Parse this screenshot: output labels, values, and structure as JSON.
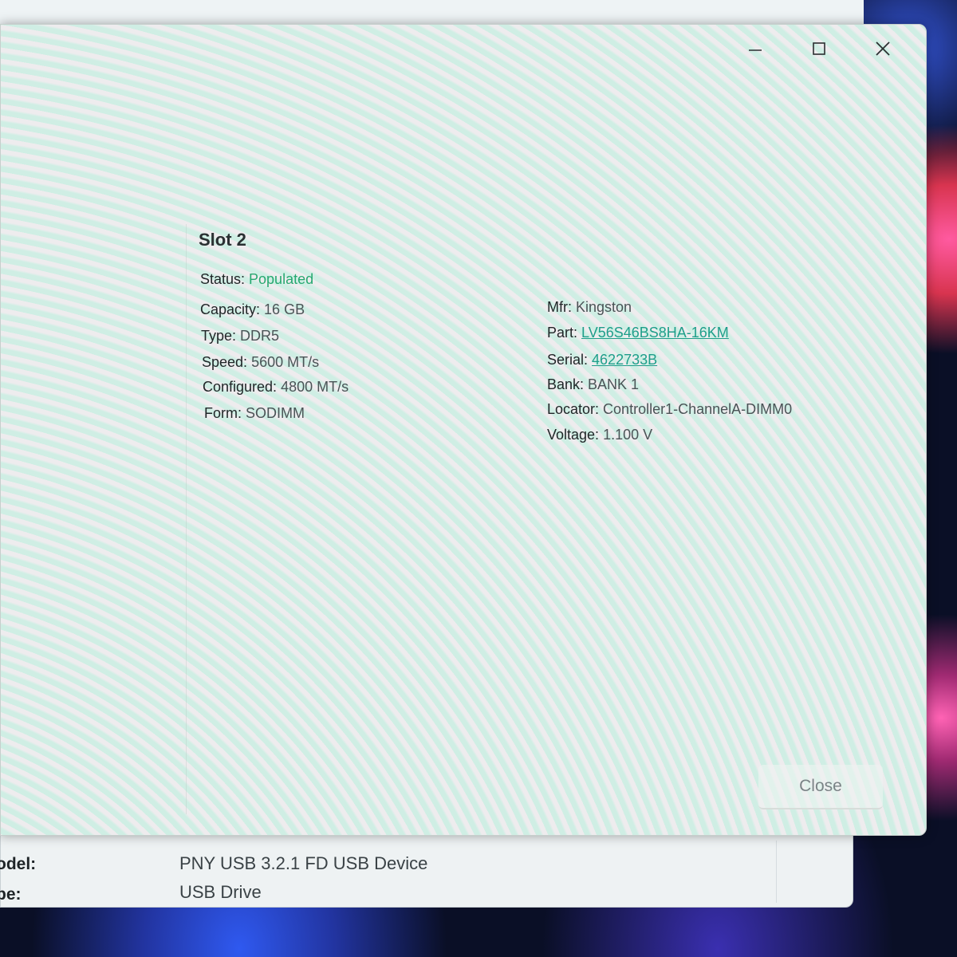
{
  "dialog": {
    "controls": {
      "minimize": "minimize",
      "maximize": "maximize",
      "close": "close"
    },
    "slot_title": "Slot 2",
    "left_fields": [
      {
        "key": "Status:",
        "value": "Populated"
      },
      {
        "key": "Capacity:",
        "value": "16 GB"
      },
      {
        "key": "Type:",
        "value": "DDR5"
      },
      {
        "key": "Speed:",
        "value": "5600 MT/s"
      },
      {
        "key": "Configured:",
        "value": "4800 MT/s"
      },
      {
        "key": "Form:",
        "value": "SODIMM"
      }
    ],
    "right_fields": [
      {
        "key": "Mfr:",
        "value": "Kingston"
      },
      {
        "key": "Part:",
        "value": "LV56S46BS8HA-16KM"
      },
      {
        "key": "Serial:",
        "value": "4622733B"
      },
      {
        "key": "Bank:",
        "value": "BANK 1"
      },
      {
        "key": "Locator:",
        "value": "Controller1-ChannelA-DIMM0"
      },
      {
        "key": "Voltage:",
        "value": "1.100 V"
      }
    ],
    "close_label": "Close",
    "status_color": "#27a870",
    "link_color": "#1e9e8a"
  },
  "background_window": {
    "rows": [
      {
        "label": "odel:",
        "value": "PNY USB 3.2.1 FD USB Device"
      },
      {
        "label": "pe:",
        "value": "USB Drive"
      }
    ]
  }
}
